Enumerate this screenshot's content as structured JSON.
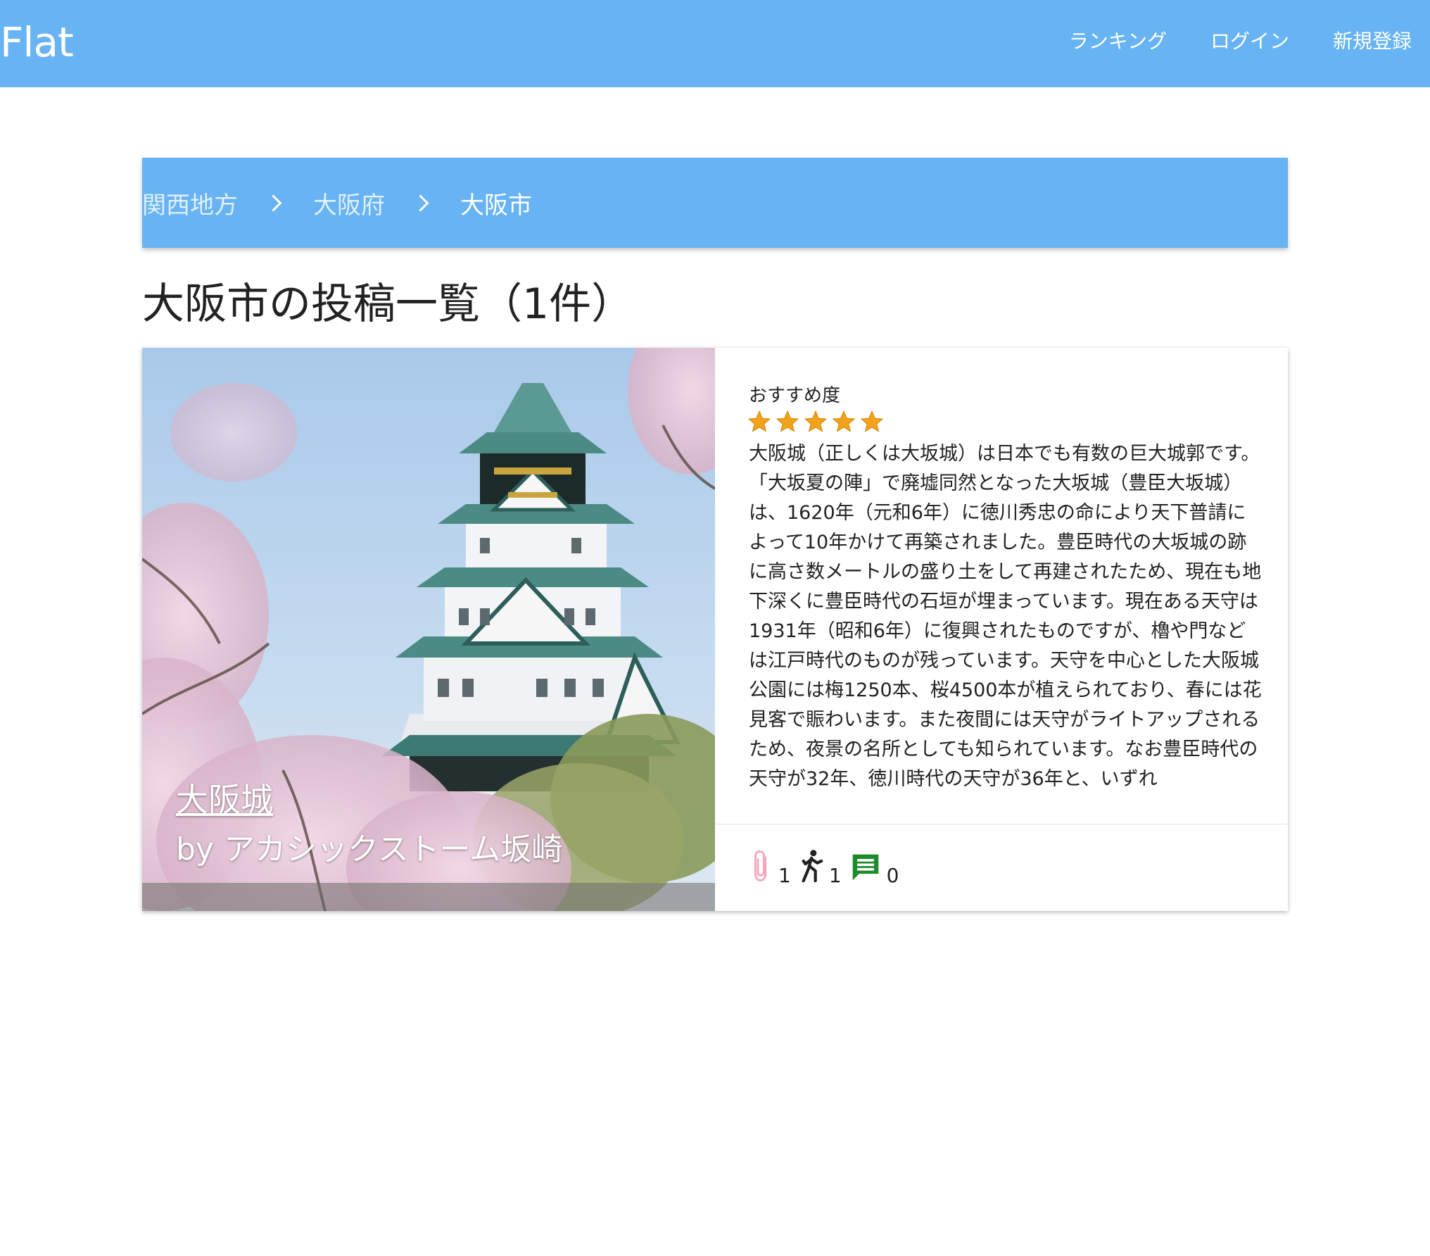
{
  "navbar": {
    "brand": "Flat",
    "links": [
      "ランキング",
      "ログイン",
      "新規登録"
    ],
    "background_color": "#67b3f3"
  },
  "breadcrumb": {
    "items": [
      "関西地方",
      "大阪府",
      "大阪市"
    ]
  },
  "page_title": "大阪市の投稿一覧（1件）",
  "posts": [
    {
      "title": "大阪城",
      "author": "by アカシックストーム坂崎",
      "rating_label": "おすすめ度",
      "rating": 5,
      "rating_max": 5,
      "description": "大阪城（正しくは大坂城）は日本でも有数の巨大城郭です。「大坂夏の陣」で廃墟同然となった大坂城（豊臣大坂城）は、1620年（元和6年）に徳川秀忠の命により天下普請によって10年かけて再築されました。豊臣時代の大坂城の跡に高さ数メートルの盛り土をして再建されたため、現在も地下深くに豊臣時代の石垣が埋まっています。現在ある天守は1931年（昭和6年）に復興されたものですが、櫓や門などは江戸時代のものが残っています。天守を中心とした大阪城公園には梅1250本、桜4500本が植えられており、春には花見客で賑わいます。また夜間には天守がライトアップされるため、夜景の名所としても知られています。なお豊臣時代の天守が32年、徳川時代の天守が36年と、いずれ",
      "image_icon": "osaka-castle-photo",
      "stats": [
        {
          "icon": "paperclip-icon",
          "count": "1",
          "color": "#f4a7b9"
        },
        {
          "icon": "walking-person-icon",
          "count": "1",
          "color": "#222222"
        },
        {
          "icon": "comment-icon",
          "count": "0",
          "color": "#1e8a2a"
        }
      ]
    }
  ]
}
